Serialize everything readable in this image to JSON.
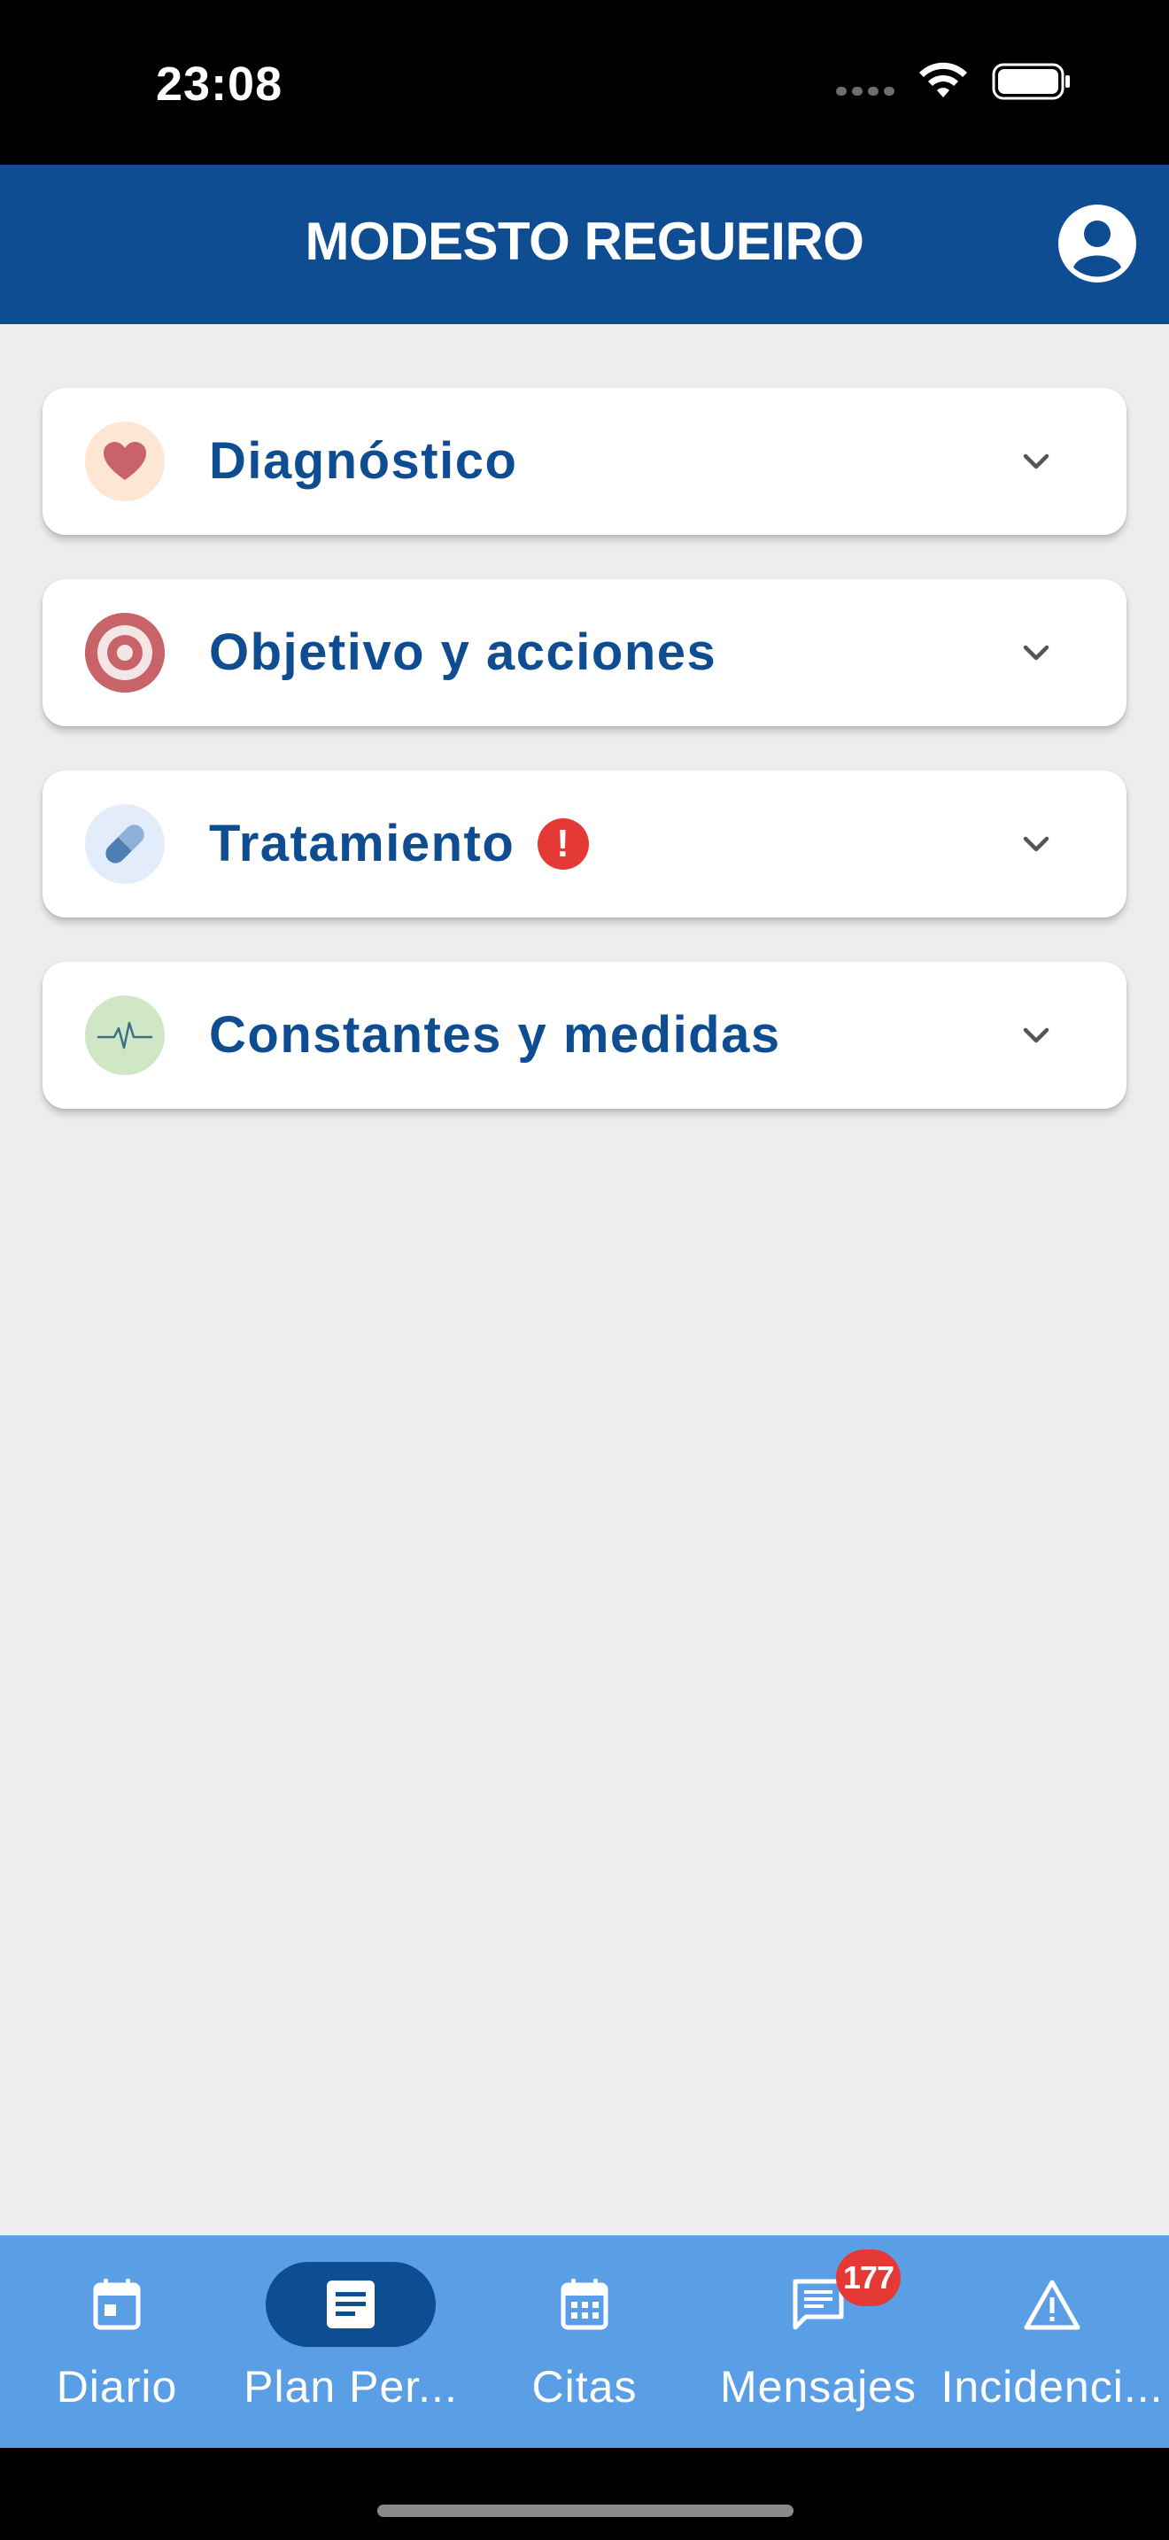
{
  "status_bar": {
    "time": "23:08"
  },
  "header": {
    "title": "MODESTO REGUEIRO"
  },
  "sections": [
    {
      "label": "Diagnóstico",
      "icon": "heart-icon",
      "icon_bg": "#fde6d4",
      "icon_color": "#c9636a"
    },
    {
      "label": "Objetivo y acciones",
      "icon": "target-icon",
      "icon_bg": "#c9636a",
      "icon_color": "#f5e6e6"
    },
    {
      "label": "Tratamiento",
      "icon": "pill-icon",
      "icon_bg": "#e3ecfb",
      "icon_color": "#4e7fb3",
      "alert": "!"
    },
    {
      "label": "Constantes y medidas",
      "icon": "heartbeat-icon",
      "icon_bg": "#cfe7c4",
      "icon_color": "#3d6f86"
    }
  ],
  "bottom_nav": {
    "items": [
      {
        "label": "Diario",
        "icon": "calendar-day-icon"
      },
      {
        "label": "Plan Per...",
        "icon": "document-icon",
        "active": true
      },
      {
        "label": "Citas",
        "icon": "calendar-icon"
      },
      {
        "label": "Mensajes",
        "icon": "chat-icon",
        "badge": "177"
      },
      {
        "label": "Incidenci...",
        "icon": "warning-icon"
      }
    ]
  },
  "colors": {
    "primary": "#0f4d93",
    "nav_bg": "#5a9fe6",
    "page_bg": "#ededed",
    "alert": "#e53935"
  }
}
